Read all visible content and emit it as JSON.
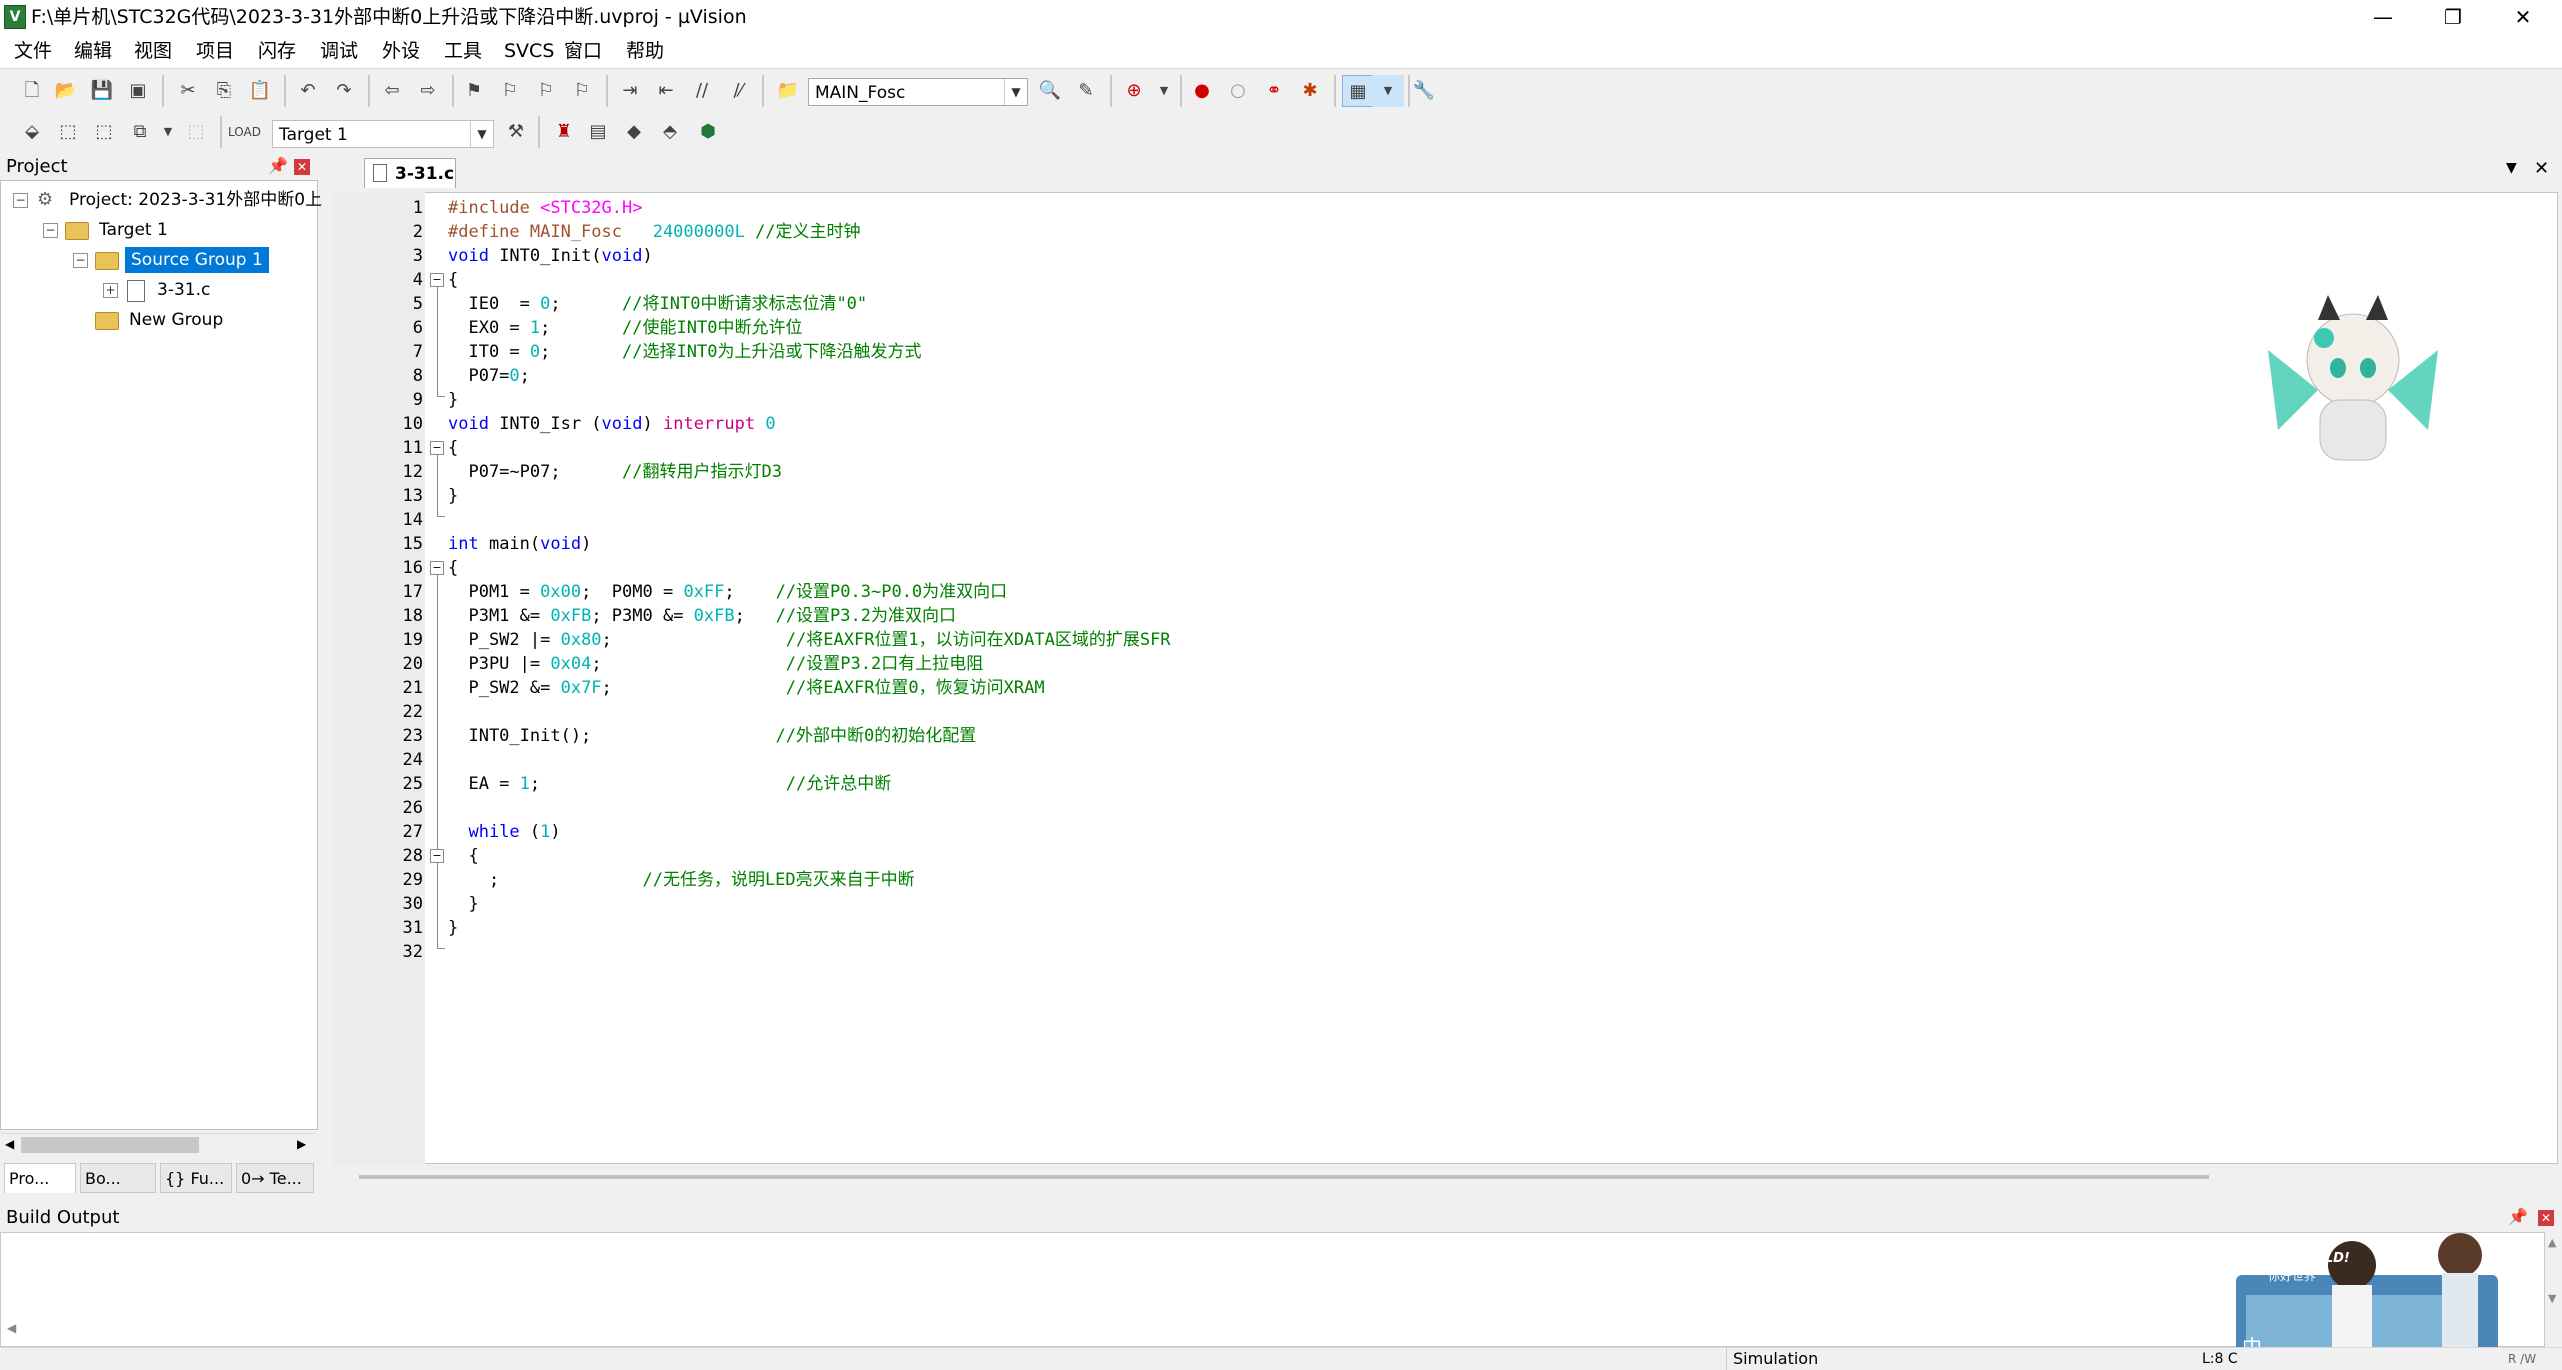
{
  "window": {
    "title": "F:\\单片机\\STC32G代码\\2023-3-31外部中断0上升沿或下降沿中断.uvproj - µVision",
    "app_icon": "V",
    "minimize": "—",
    "restore": "❐",
    "close": "✕"
  },
  "menu": [
    "文件",
    "编辑",
    "视图",
    "项目",
    "闪存",
    "调试",
    "外设",
    "工具",
    "SVCS",
    "窗口",
    "帮助"
  ],
  "toolbar1": {
    "define_combo": "MAIN_Fosc"
  },
  "toolbar2": {
    "target_combo": "Target 1"
  },
  "project_panel": {
    "title": "Project",
    "project_label": "Project: 2023-3-31外部中断0上",
    "target_label": "Target 1",
    "source_group_label": "Source Group 1",
    "file_label": "3-31.c",
    "new_group_label": "New Group",
    "tabs": [
      "Pro...",
      "Bo...",
      "{} Fu...",
      "0→ Te..."
    ]
  },
  "editor": {
    "tab_label": "3-31.c",
    "line_numbers": [
      "1",
      "2",
      "3",
      "4",
      "5",
      "6",
      "7",
      "8",
      "9",
      "10",
      "11",
      "12",
      "13",
      "14",
      "15",
      "16",
      "17",
      "18",
      "19",
      "20",
      "21",
      "22",
      "23",
      "24",
      "25",
      "26",
      "27",
      "28",
      "29",
      "30",
      "31",
      "32"
    ]
  },
  "code": {
    "l1a": "#include ",
    "l1b": "<STC32G.H>",
    "l2a": "#define MAIN_Fosc   ",
    "l2b": "24000000L",
    "l2c": " //定义主时钟",
    "l3a": "void",
    "l3b": " INT0_Init(",
    "l3c": "void",
    "l3d": ")",
    "l4": "{",
    "l5a": "  IE0  = ",
    "l5b": "0",
    "l5c": ";      ",
    "l5d": "//将INT0中断请求标志位清\"0\"",
    "l6a": "  EX0 = ",
    "l6b": "1",
    "l6c": ";       ",
    "l6d": "//使能INT0中断允许位",
    "l7a": "  IT0 = ",
    "l7b": "0",
    "l7c": ";       ",
    "l7d": "//选择INT0为上升沿或下降沿触发方式",
    "l8a": "  P07=",
    "l8b": "0",
    "l8c": ";",
    "l9": "}",
    "l10a": "void",
    "l10b": " INT0_Isr (",
    "l10c": "void",
    "l10d": ") ",
    "l10e": "interrupt",
    "l10f": " 0",
    "l11": "{",
    "l12a": "  P07=~P07;      ",
    "l12b": "//翻转用户指示灯D3",
    "l13": "}",
    "l15a": "int",
    "l15b": " main(",
    "l15c": "void",
    "l15d": ")",
    "l16": "{",
    "l17a": "  P0M1 = ",
    "l17b": "0x00",
    "l17c": ";  P0M0 = ",
    "l17d": "0xFF",
    "l17e": ";    ",
    "l17f": "//设置P0.3~P0.0为准双向口",
    "l18a": "  P3M1 &= ",
    "l18b": "0xFB",
    "l18c": "; P3M0 &= ",
    "l18d": "0xFB",
    "l18e": ";   ",
    "l18f": "//设置P3.2为准双向口",
    "l19a": "  P_SW2 |= ",
    "l19b": "0x80",
    "l19c": ";                 ",
    "l19d": "//将EAXFR位置1，以访问在XDATA区域的扩展SFR",
    "l20a": "  P3PU |= ",
    "l20b": "0x04",
    "l20c": ";                  ",
    "l20d": "//设置P3.2口有上拉电阻",
    "l21a": "  P_SW2 &= ",
    "l21b": "0x7F",
    "l21c": ";                 ",
    "l21d": "//将EAXFR位置0，恢复访问XRAM",
    "l23a": "  INT0_Init();                  ",
    "l23b": "//外部中断0的初始化配置",
    "l25a": "  EA = ",
    "l25b": "1",
    "l25c": ";                        ",
    "l25d": "//允许总中断",
    "l27a": "  ",
    "l27b": "while",
    "l27c": " (",
    "l27d": "1",
    "l27e": ")",
    "l28": "  {",
    "l29a": "    ;              ",
    "l29b": "//无任务，说明LED亮灭来自于中断",
    "l30": "  }",
    "l31": "}"
  },
  "build_output": {
    "title": "Build Output"
  },
  "status": {
    "mode": "Simulation",
    "position": "L:8 C",
    "rw": "R /W"
  },
  "banner": {
    "line1": "HELLO WORLD!",
    "line2": "你好世界",
    "ime": "中"
  },
  "colors": {
    "keyword": "#0000ff",
    "preprocessor": "#a0522d",
    "number": "#00b3b3",
    "comment": "#008000",
    "header_string": "#ff00ff",
    "interrupt_kw": "#d0007f",
    "selection": "#0078d7"
  }
}
